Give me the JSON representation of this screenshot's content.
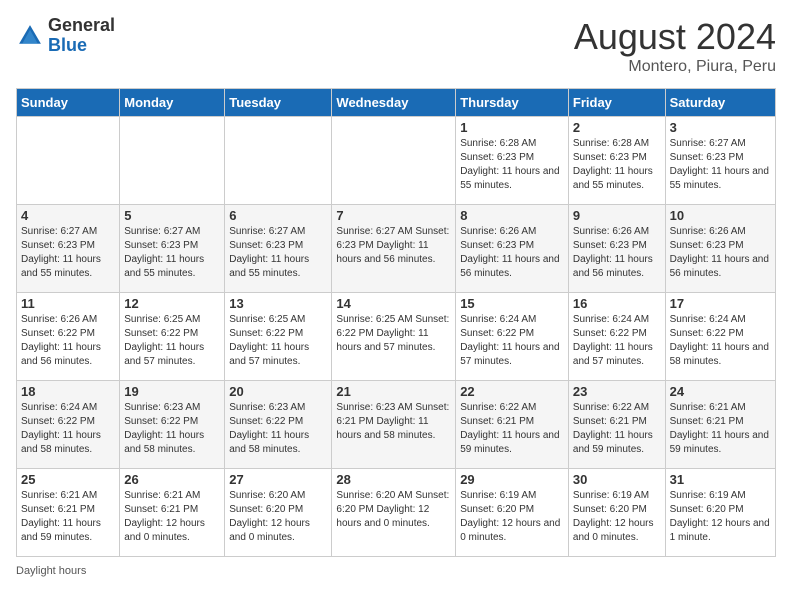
{
  "header": {
    "logo_general": "General",
    "logo_blue": "Blue",
    "calendar_title": "August 2024",
    "calendar_subtitle": "Montero, Piura, Peru"
  },
  "days_of_week": [
    "Sunday",
    "Monday",
    "Tuesday",
    "Wednesday",
    "Thursday",
    "Friday",
    "Saturday"
  ],
  "weeks": [
    [
      {
        "day": "",
        "info": ""
      },
      {
        "day": "",
        "info": ""
      },
      {
        "day": "",
        "info": ""
      },
      {
        "day": "",
        "info": ""
      },
      {
        "day": "1",
        "info": "Sunrise: 6:28 AM\nSunset: 6:23 PM\nDaylight: 11 hours and 55 minutes."
      },
      {
        "day": "2",
        "info": "Sunrise: 6:28 AM\nSunset: 6:23 PM\nDaylight: 11 hours and 55 minutes."
      },
      {
        "day": "3",
        "info": "Sunrise: 6:27 AM\nSunset: 6:23 PM\nDaylight: 11 hours and 55 minutes."
      }
    ],
    [
      {
        "day": "4",
        "info": "Sunrise: 6:27 AM\nSunset: 6:23 PM\nDaylight: 11 hours and 55 minutes."
      },
      {
        "day": "5",
        "info": "Sunrise: 6:27 AM\nSunset: 6:23 PM\nDaylight: 11 hours and 55 minutes."
      },
      {
        "day": "6",
        "info": "Sunrise: 6:27 AM\nSunset: 6:23 PM\nDaylight: 11 hours and 55 minutes."
      },
      {
        "day": "7",
        "info": "Sunrise: 6:27 AM\nSunset: 6:23 PM\nDaylight: 11 hours and 56 minutes."
      },
      {
        "day": "8",
        "info": "Sunrise: 6:26 AM\nSunset: 6:23 PM\nDaylight: 11 hours and 56 minutes."
      },
      {
        "day": "9",
        "info": "Sunrise: 6:26 AM\nSunset: 6:23 PM\nDaylight: 11 hours and 56 minutes."
      },
      {
        "day": "10",
        "info": "Sunrise: 6:26 AM\nSunset: 6:23 PM\nDaylight: 11 hours and 56 minutes."
      }
    ],
    [
      {
        "day": "11",
        "info": "Sunrise: 6:26 AM\nSunset: 6:22 PM\nDaylight: 11 hours and 56 minutes."
      },
      {
        "day": "12",
        "info": "Sunrise: 6:25 AM\nSunset: 6:22 PM\nDaylight: 11 hours and 57 minutes."
      },
      {
        "day": "13",
        "info": "Sunrise: 6:25 AM\nSunset: 6:22 PM\nDaylight: 11 hours and 57 minutes."
      },
      {
        "day": "14",
        "info": "Sunrise: 6:25 AM\nSunset: 6:22 PM\nDaylight: 11 hours and 57 minutes."
      },
      {
        "day": "15",
        "info": "Sunrise: 6:24 AM\nSunset: 6:22 PM\nDaylight: 11 hours and 57 minutes."
      },
      {
        "day": "16",
        "info": "Sunrise: 6:24 AM\nSunset: 6:22 PM\nDaylight: 11 hours and 57 minutes."
      },
      {
        "day": "17",
        "info": "Sunrise: 6:24 AM\nSunset: 6:22 PM\nDaylight: 11 hours and 58 minutes."
      }
    ],
    [
      {
        "day": "18",
        "info": "Sunrise: 6:24 AM\nSunset: 6:22 PM\nDaylight: 11 hours and 58 minutes."
      },
      {
        "day": "19",
        "info": "Sunrise: 6:23 AM\nSunset: 6:22 PM\nDaylight: 11 hours and 58 minutes."
      },
      {
        "day": "20",
        "info": "Sunrise: 6:23 AM\nSunset: 6:22 PM\nDaylight: 11 hours and 58 minutes."
      },
      {
        "day": "21",
        "info": "Sunrise: 6:23 AM\nSunset: 6:21 PM\nDaylight: 11 hours and 58 minutes."
      },
      {
        "day": "22",
        "info": "Sunrise: 6:22 AM\nSunset: 6:21 PM\nDaylight: 11 hours and 59 minutes."
      },
      {
        "day": "23",
        "info": "Sunrise: 6:22 AM\nSunset: 6:21 PM\nDaylight: 11 hours and 59 minutes."
      },
      {
        "day": "24",
        "info": "Sunrise: 6:21 AM\nSunset: 6:21 PM\nDaylight: 11 hours and 59 minutes."
      }
    ],
    [
      {
        "day": "25",
        "info": "Sunrise: 6:21 AM\nSunset: 6:21 PM\nDaylight: 11 hours and 59 minutes."
      },
      {
        "day": "26",
        "info": "Sunrise: 6:21 AM\nSunset: 6:21 PM\nDaylight: 12 hours and 0 minutes."
      },
      {
        "day": "27",
        "info": "Sunrise: 6:20 AM\nSunset: 6:20 PM\nDaylight: 12 hours and 0 minutes."
      },
      {
        "day": "28",
        "info": "Sunrise: 6:20 AM\nSunset: 6:20 PM\nDaylight: 12 hours and 0 minutes."
      },
      {
        "day": "29",
        "info": "Sunrise: 6:19 AM\nSunset: 6:20 PM\nDaylight: 12 hours and 0 minutes."
      },
      {
        "day": "30",
        "info": "Sunrise: 6:19 AM\nSunset: 6:20 PM\nDaylight: 12 hours and 0 minutes."
      },
      {
        "day": "31",
        "info": "Sunrise: 6:19 AM\nSunset: 6:20 PM\nDaylight: 12 hours and 1 minute."
      }
    ]
  ],
  "footer": {
    "daylight_label": "Daylight hours"
  }
}
